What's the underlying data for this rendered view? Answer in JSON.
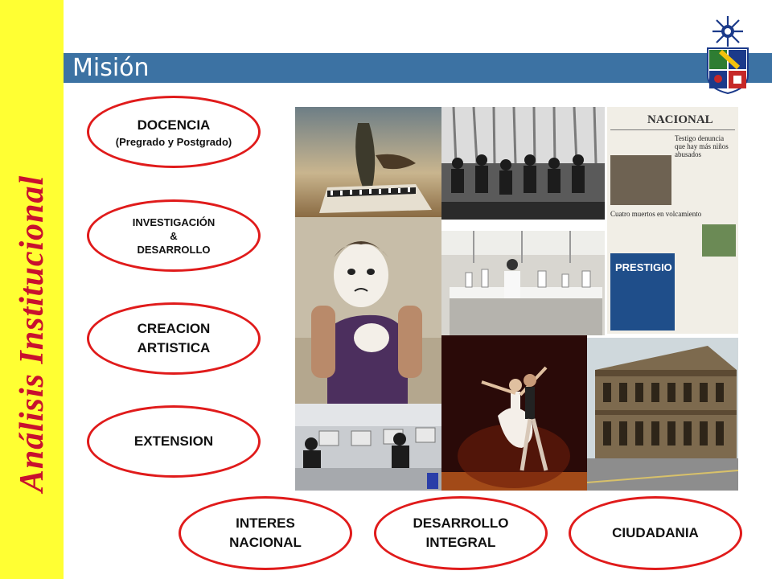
{
  "sidebar": {
    "text": "Análisis Institucional"
  },
  "header": {
    "title": "Misión"
  },
  "ovals": {
    "docencia": {
      "line1": "DOCENCIA",
      "line2": "(Pregrado y Postgrado)"
    },
    "investigacion": {
      "line1": "INVESTIGACIÓN",
      "line2": "&",
      "line3": "DESARROLLO"
    },
    "creacion": {
      "line1": "CREACION",
      "line2": "ARTISTICA"
    },
    "extension": {
      "line1": "EXTENSION"
    },
    "interes": {
      "line1": "INTERES",
      "line2": "NACIONAL"
    },
    "desarrollo": {
      "line1": "DESARROLLO",
      "line2": "INTEGRAL"
    },
    "ciudadania": {
      "line1": "CIUDADANIA"
    }
  },
  "newspaper": {
    "masthead": "NACIONAL",
    "headline1": "Testigo denuncia que hay más niños abusados",
    "headline2": "Cuatro muertos en volcamiento",
    "ad": "PRESTIGIO"
  },
  "colors": {
    "sidebar": "#ffff33",
    "sidebar_text": "#c8102e",
    "title_bar": "#3c72a3",
    "oval_border": "#e01b1b"
  }
}
